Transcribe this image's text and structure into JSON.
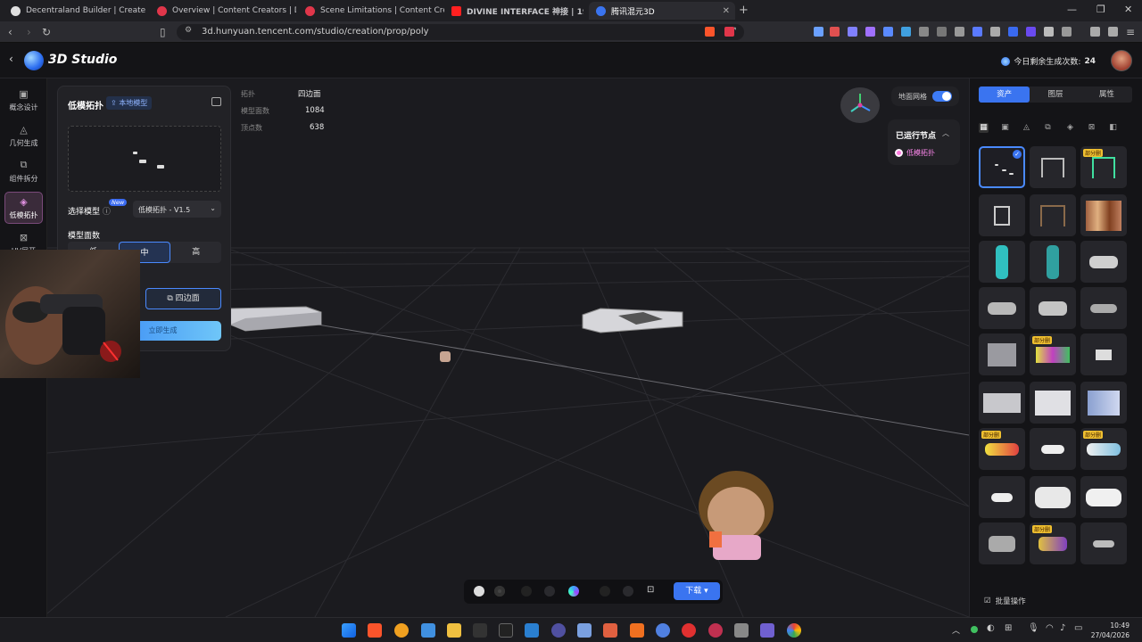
{
  "browser": {
    "tabs": [
      {
        "title": "Decentraland Builder | Create Scenes",
        "color": "#e0e0e0"
      },
      {
        "title": "Overview | Content Creators | Decentr",
        "color": "#e0364a"
      },
      {
        "title": "Scene Limitations | Content Creators",
        "color": "#e0364a"
      },
      {
        "title": "DIVINE INTERFACE 神接 | 1990s",
        "color": "#ff2020"
      },
      {
        "title": "腾讯混元3D",
        "color": "#3a74f0"
      }
    ],
    "new_tab": "+",
    "url": "3d.hunyuan.tencent.com/studio/creation/prop/poly"
  },
  "app": {
    "title": "3D Studio",
    "quota_label": "今日剩余生成次数:",
    "quota_value": "24"
  },
  "rail": [
    {
      "label": "概念设计",
      "icon": "image-icon"
    },
    {
      "label": "几何生成",
      "icon": "shapes-icon"
    },
    {
      "label": "组件拆分",
      "icon": "split-icon"
    },
    {
      "label": "低模拓扑",
      "icon": "topology-icon",
      "active": true
    },
    {
      "label": "UV展开",
      "icon": "uv-icon"
    }
  ],
  "left_panel": {
    "title": "低模拓扑",
    "local_model_button": "本地模型",
    "select_model_label": "选择模型",
    "new_badge": "New",
    "select_value": "低模拓扑 - V1.5",
    "face_count_label": "模型面数",
    "segments": [
      "低",
      "中",
      "高"
    ],
    "active_segment": "中",
    "quad_button": "四边面",
    "generate_button": "立即生成"
  },
  "stats": {
    "topology_label": "拓扑",
    "topology_value": "四边面",
    "faces_label": "模型面数",
    "faces_value": "1084",
    "vertices_label": "顶点数",
    "vertices_value": "638"
  },
  "viewport": {
    "mesh_toggle_label": "地面网格",
    "mesh_toggle_on": true
  },
  "node_panel": {
    "title": "已运行节点",
    "item": "低模拓扑"
  },
  "bottom_toolbar": {
    "download_label": "下载"
  },
  "right_panel": {
    "tabs": [
      "资产",
      "图层",
      "属性"
    ],
    "active_tab": "资产",
    "tag_label": "部分删",
    "batch_label": "批量操作"
  },
  "taskbar": {
    "time": "10:49",
    "date": "27/04/2026"
  }
}
